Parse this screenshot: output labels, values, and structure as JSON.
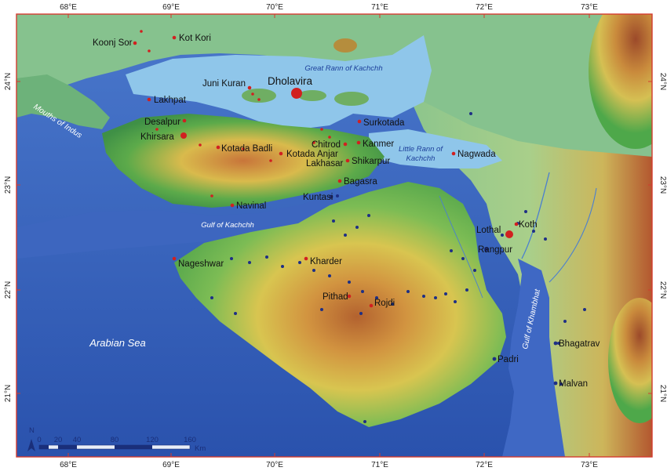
{
  "axes": {
    "lon_ticks": [
      "68°E",
      "69°E",
      "70°E",
      "71°E",
      "72°E",
      "73°E"
    ],
    "lat_ticks": [
      "24°N",
      "23°N",
      "22°N",
      "21°N"
    ]
  },
  "water_labels": {
    "great_rann": "Great Rann of Kachchh",
    "little_rann_1": "Little Rann of",
    "little_rann_2": "Kachchh",
    "gulf_kachchh": "Gulf of Kachchh",
    "mouths_indus": "Mouths of Indus",
    "arabian_sea": "Arabian Sea",
    "gulf_khambhat": "Gulf of Khambhat"
  },
  "places": {
    "koonj_sor": "Koonj Sor",
    "kot_kori": "Kot Kori",
    "juni_kuran": "Juni Kuran",
    "dholavira": "Dholavira",
    "lakhpat": "Lakhpat",
    "desalpur": "Desalpur",
    "khirsara": "Khirsara",
    "surkotada": "Surkotada",
    "chitrod": "Chitrod",
    "kanmer": "Kanmer",
    "kotada_badli": "Kotada Badli",
    "kotada_anjar": "Kotada Anjar",
    "lakhasar": "Lakhasar",
    "shikarpur": "Shikarpur",
    "nagwada": "Nagwada",
    "bagasra": "Bagasra",
    "kuntasi": "Kuntasi",
    "navinal": "Navinal",
    "lothal": "Lothal",
    "koth": "Koth",
    "rangpur": "Rangpur",
    "nageshwar": "Nageshwar",
    "kharder": "Kharder",
    "pithad": "Pithad",
    "rojdi": "Rojdi",
    "padri": "Padri",
    "bhagatrav": "Bhagatrav",
    "malvan": "Malvan"
  },
  "scale": {
    "north": "N",
    "ticks": [
      "0",
      "20",
      "40",
      "80",
      "120",
      "160"
    ],
    "unit": "Km"
  },
  "colors": {
    "sea_deep": "#2d58b4",
    "sea_shallow": "#5a84d4",
    "rann": "#8fc6ea",
    "lowland": "#7fc18a",
    "green": "#45a04a",
    "yellow": "#d8c24a",
    "orange": "#cf8a3c",
    "brown": "#a5532c",
    "frame": "#d43b2f",
    "harappan_site": "#d12020",
    "other_site": "#1e2f85"
  }
}
